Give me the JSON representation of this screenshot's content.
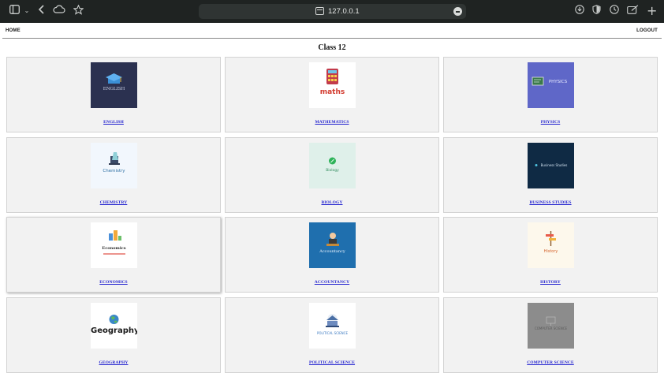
{
  "browser": {
    "url": "127.0.0.1"
  },
  "nav": {
    "home": "HOME",
    "logout": "LOGOUT"
  },
  "page": {
    "title": "Class 12"
  },
  "subjects": [
    {
      "name": "ENGLISH",
      "thumb_text": "ENGLISH"
    },
    {
      "name": "MATHEMATICS",
      "thumb_text": "maths"
    },
    {
      "name": "PHYSICS",
      "thumb_text": "PHYSICS"
    },
    {
      "name": "CHEMISTRY",
      "thumb_text": "Chemistry"
    },
    {
      "name": "BIOLOGY",
      "thumb_text": "Biology"
    },
    {
      "name": "BUSINESS STUDIES",
      "thumb_text": "Business Studies"
    },
    {
      "name": "ECONOMICS",
      "thumb_text": "Economics"
    },
    {
      "name": "ACCOUNTANCY",
      "thumb_text": "Accountancy"
    },
    {
      "name": "HISTORY",
      "thumb_text": "History"
    },
    {
      "name": "GEOGRAPHY",
      "thumb_text": "Geography"
    },
    {
      "name": "POLITICAL SCIENCE",
      "thumb_text": "POLITICAL SCIENCE"
    },
    {
      "name": "COMPUTER SCIENCE",
      "thumb_text": "COMPUTER SCIENCE"
    }
  ],
  "colors": {
    "link": "#1f1fcf",
    "card_bg": "#f2f2f2",
    "chrome_bg": "#1f2322"
  }
}
